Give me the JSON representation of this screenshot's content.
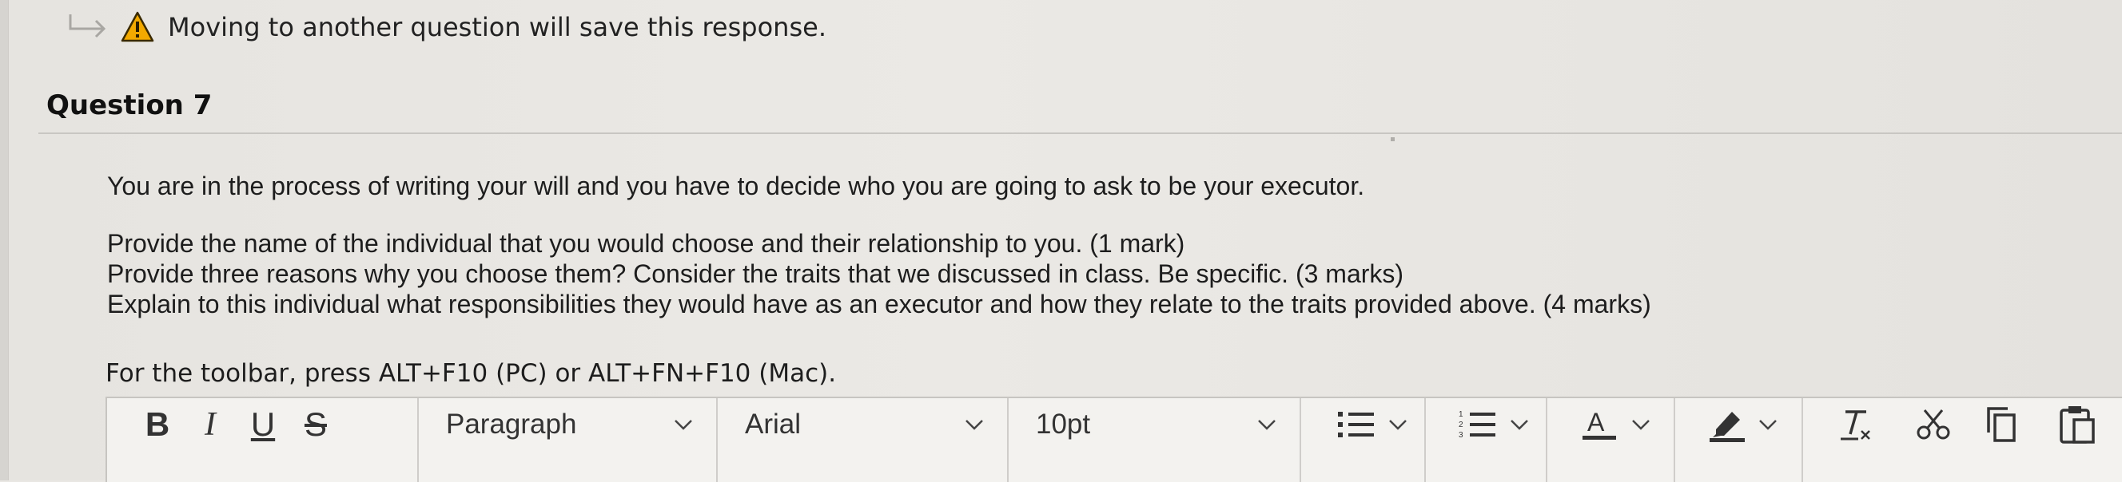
{
  "notice": {
    "text": "Moving to another question will save this response.",
    "icon": "warning-triangle-icon",
    "arrow_icon": "return-arrow-icon"
  },
  "question": {
    "title": "Question 7",
    "intro": "You are in the process of writing your will and you have to decide who you are going to ask to be your executor.",
    "lines": [
      "Provide the name of the individual that you would choose and their relationship to you. (1 mark)",
      "Provide three reasons why you choose them? Consider the traits that we discussed in class. Be specific. (3 marks)",
      "Explain to this individual what responsibilities they would have as an executor and how they relate to the traits provided above. (4 marks)"
    ]
  },
  "editor": {
    "toolbar_hint": "For the toolbar, press ALT+F10 (PC) or ALT+FN+F10 (Mac).",
    "toolbar": {
      "bold": "B",
      "italic": "I",
      "underline": "U",
      "strikethrough": "S",
      "block_format": "Paragraph",
      "font_family": "Arial",
      "font_size": "10pt",
      "text_color_letter": "A"
    },
    "icons": [
      "bullet-list-icon",
      "numbered-list-icon",
      "text-color-icon",
      "highlight-icon",
      "clear-formatting-icon",
      "cut-icon",
      "copy-icon",
      "paste-icon"
    ]
  },
  "colors": {
    "page_background": "#e9e7e3",
    "warning_fill": "#f2a900",
    "toolbar_background": "#f3f2ef",
    "icon_color": "#333333"
  }
}
